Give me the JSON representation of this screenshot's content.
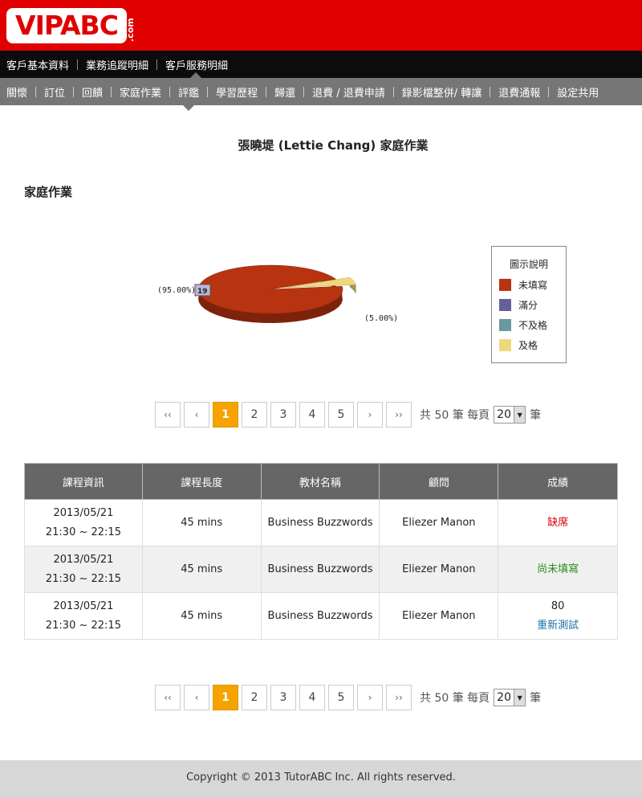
{
  "brand": {
    "logo_text": "VIPABC",
    "logo_suffix": ".com"
  },
  "nav_primary": [
    {
      "label": "客戶基本資料"
    },
    {
      "label": "業務追蹤明細"
    },
    {
      "label": "客戶服務明細",
      "active": true
    }
  ],
  "nav_secondary": [
    {
      "label": "關懷"
    },
    {
      "label": "訂位"
    },
    {
      "label": "回饋"
    },
    {
      "label": "家庭作業",
      "active": true
    },
    {
      "label": "評鑑"
    },
    {
      "label": "學習歷程"
    },
    {
      "label": "歸還"
    },
    {
      "label": "退費 / 退費申請"
    },
    {
      "label": "錄影檔整併/ 轉讓"
    },
    {
      "label": "退費通報"
    },
    {
      "label": "設定共用"
    }
  ],
  "page_title": "張曉堤 (Lettie Chang) 家庭作業",
  "section_title": "家庭作業",
  "chart_data": {
    "type": "pie",
    "categories": [
      "未填寫",
      "滿分",
      "不及格",
      "及格"
    ],
    "values": [
      19,
      0,
      0,
      1
    ],
    "percent_labels": [
      "(95.00%)",
      "",
      "",
      "(5.00%)"
    ],
    "value_label": "19",
    "colors": [
      "#b83310",
      "#66609a",
      "#6a98a0",
      "#efd87c"
    ],
    "legend_title": "圖示說明",
    "legend_position": "right"
  },
  "pager": {
    "first": "‹‹",
    "prev": "‹",
    "pages": [
      "1",
      "2",
      "3",
      "4",
      "5"
    ],
    "current_page": "1",
    "next": "›",
    "last": "››",
    "total_text": "共 50 筆 每頁",
    "per_page": "20",
    "suffix": "筆"
  },
  "table": {
    "headers": [
      "課程資訊",
      "課程長度",
      "教材名稱",
      "顧問",
      "成績"
    ],
    "rows": [
      {
        "date": "2013/05/21",
        "time": "21:30 ~ 22:15",
        "length": "45 mins",
        "material": "Business Buzzwords",
        "consultant": "Eliezer Manon",
        "score": "",
        "status": "缺席",
        "status_type": "absent"
      },
      {
        "date": "2013/05/21",
        "time": "21:30 ~ 22:15",
        "length": "45 mins",
        "material": "Business Buzzwords",
        "consultant": "Eliezer Manon",
        "score": "",
        "status": "尚未填寫",
        "status_type": "pending"
      },
      {
        "date": "2013/05/21",
        "time": "21:30 ~ 22:15",
        "length": "45 mins",
        "material": "Business Buzzwords",
        "consultant": "Eliezer Manon",
        "score": "80",
        "status": "重新測試",
        "status_type": "retest"
      }
    ]
  },
  "footer": {
    "copyright": "Copyright © 2013 TutorABC Inc. All rights reserved."
  }
}
